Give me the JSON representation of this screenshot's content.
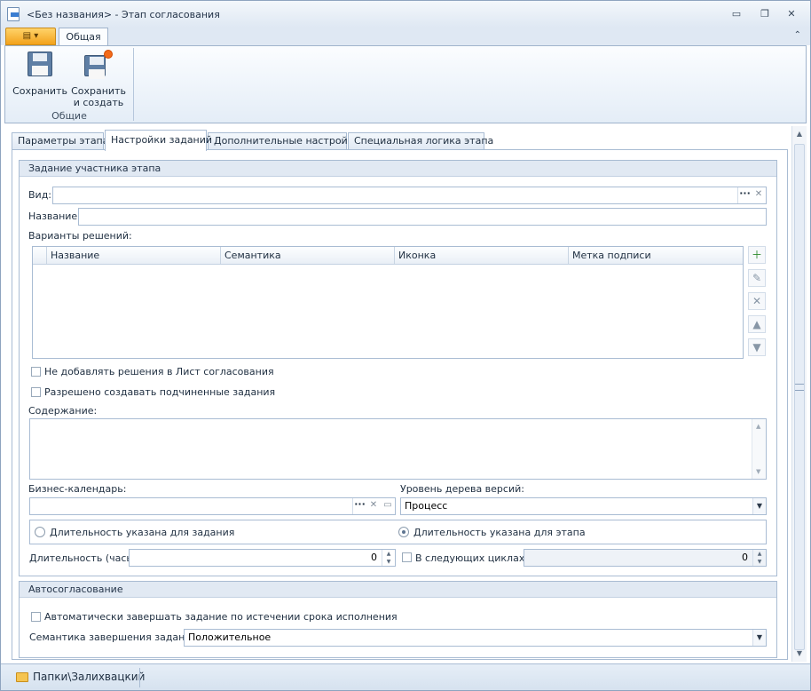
{
  "window": {
    "title": "<Без названия> - Этап согласования",
    "minimize": "▭",
    "restore": "❐",
    "close": "✕"
  },
  "ribbon": {
    "app_menu_icon": "menu-icon",
    "tab": "Общая",
    "collapse": "⌃",
    "buttons": {
      "save": "Сохранить",
      "save_create_line1": "Сохранить",
      "save_create_line2": "и создать"
    },
    "group_label": "Общие"
  },
  "tabs": [
    "Параметры этапа",
    "Настройки заданий",
    "Дополнительные настройки",
    "Специальная логика этапа"
  ],
  "task_group": {
    "header": "Задание участника этапа",
    "kind_label": "Вид:",
    "kind_value": "",
    "name_label": "Название:",
    "name_value": "",
    "variants_label": "Варианты решений:",
    "columns": [
      "Название",
      "Семантика",
      "Иконка",
      "Метка подписи"
    ],
    "chk_no_add": "Не добавлять решения в Лист согласования",
    "chk_allow_sub": "Разрешено создавать подчиненные задания",
    "content_label": "Содержание:",
    "calendar_label": "Бизнес-календарь:",
    "calendar_value": "",
    "tree_label": "Уровень дерева версий:",
    "tree_value": "Процесс",
    "radio_task": "Длительность указана для задания",
    "radio_stage": "Длительность указана для этапа",
    "duration_label": "Длительность (часы)",
    "duration_value": "0",
    "next_cycles_label": "В следующих циклах",
    "next_cycles_value": "0"
  },
  "auto_group": {
    "header": "Автосогласование",
    "chk_auto": "Автоматически завершать задание по истечении срока исполнения",
    "semantics_label": "Семантика завершения задания:",
    "semantics_value": "Положительное"
  },
  "status": {
    "path": "Папки\\Залихвацкий"
  }
}
